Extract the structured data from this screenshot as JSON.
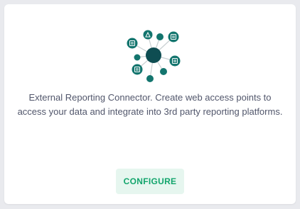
{
  "card": {
    "illustration_icon": "network-hub-icon",
    "description": "External Reporting Connector. Create web access points to access your data and integrate into 3rd party reporting platforms.",
    "configure_label": "CONFIGURE"
  },
  "colors": {
    "background": "#e9eaee",
    "card": "#ffffff",
    "hub": "#0e4d52",
    "node": "#13756e",
    "text": "#51566b",
    "button_bg": "#e6f6ef",
    "button_text": "#12a56c"
  }
}
